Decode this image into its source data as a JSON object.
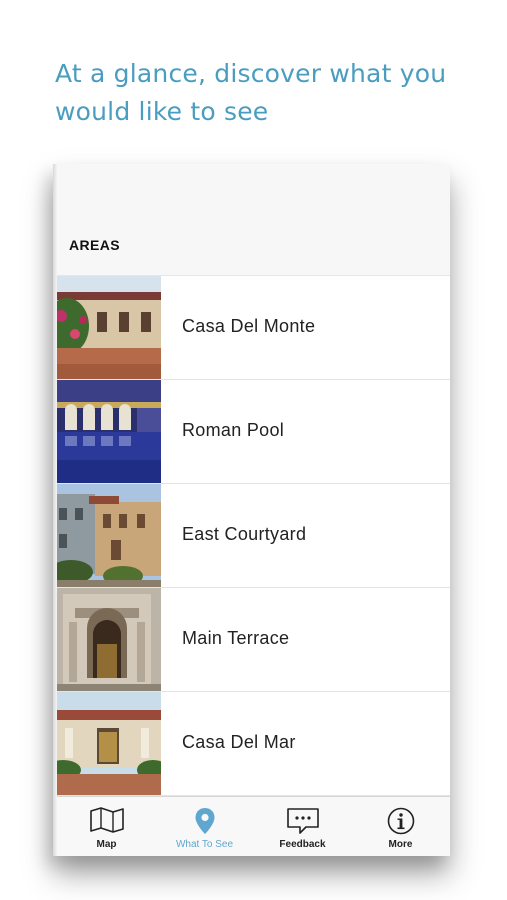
{
  "headline": {
    "line1": "At a glance, discover what you",
    "line2": "would like to see"
  },
  "section": {
    "title": "AREAS"
  },
  "areas": [
    {
      "name": "Casa Del Monte"
    },
    {
      "name": "Roman Pool"
    },
    {
      "name": "East Courtyard"
    },
    {
      "name": "Main Terrace"
    },
    {
      "name": "Casa Del Mar"
    }
  ],
  "tabs": [
    {
      "label": "Map",
      "icon": "map-icon"
    },
    {
      "label": "What To See",
      "icon": "location-pin-icon",
      "active": true
    },
    {
      "label": "Feedback",
      "icon": "speech-bubble-icon"
    },
    {
      "label": "More",
      "icon": "info-icon"
    }
  ],
  "colors": {
    "accent": "#4a9dbf",
    "active_tab": "#5fa7cf"
  }
}
